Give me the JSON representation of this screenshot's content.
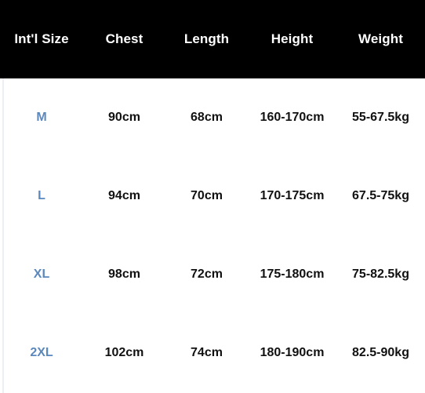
{
  "table": {
    "columns": [
      "Int'l Size",
      "Chest",
      "Length",
      "Height",
      "Weight"
    ],
    "rows": [
      {
        "size": "M",
        "chest": "90cm",
        "length": "68cm",
        "height": "160-170cm",
        "weight": "55-67.5kg"
      },
      {
        "size": "L",
        "chest": "94cm",
        "length": "70cm",
        "height": "170-175cm",
        "weight": "67.5-75kg"
      },
      {
        "size": "XL",
        "chest": "98cm",
        "length": "72cm",
        "height": "175-180cm",
        "weight": "75-82.5kg"
      },
      {
        "size": "2XL",
        "chest": "102cm",
        "length": "74cm",
        "height": "180-190cm",
        "weight": "82.5-90kg"
      }
    ]
  },
  "colors": {
    "header_background": "#000000",
    "header_text": "#ffffff",
    "body_background": "#ffffff",
    "body_text": "#111111",
    "size_label_text": "#5b88bd",
    "edge_line": "#eceef5"
  }
}
